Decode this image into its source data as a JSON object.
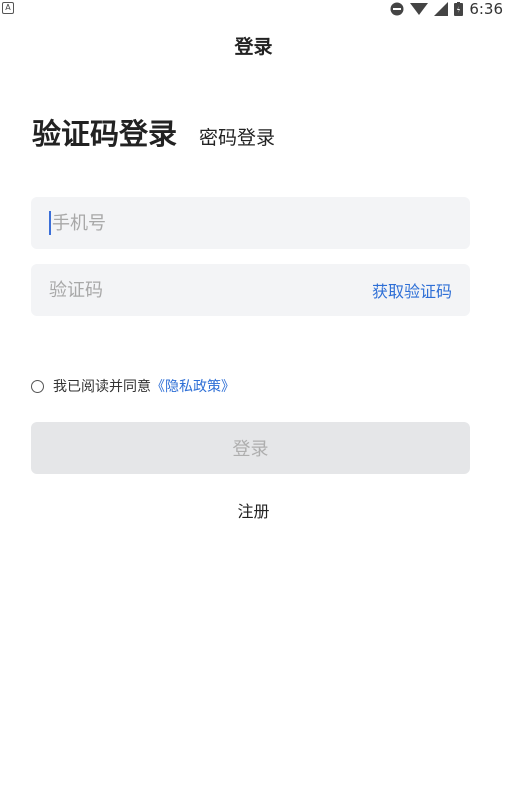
{
  "status_bar": {
    "notification_glyph": "A",
    "time": "6:36",
    "icons": [
      "do-not-disturb-icon",
      "wifi-icon",
      "signal-icon",
      "battery-icon"
    ]
  },
  "header": {
    "title": "登录"
  },
  "tabs": {
    "active_label": "验证码登录",
    "inactive_label": "密码登录"
  },
  "phone_field": {
    "placeholder": "手机号",
    "value": ""
  },
  "code_field": {
    "placeholder": "验证码",
    "value": "",
    "get_code_label": "获取验证码"
  },
  "agreement": {
    "text": "我已阅读并同意",
    "policy_link": "《隐私政策》"
  },
  "login_button_label": "登录",
  "register_label": "注册",
  "colors": {
    "accent": "#2e6fd6",
    "field_bg": "#f3f4f6",
    "button_disabled_bg": "#e5e6e8",
    "button_disabled_text": "#aeaeae"
  }
}
